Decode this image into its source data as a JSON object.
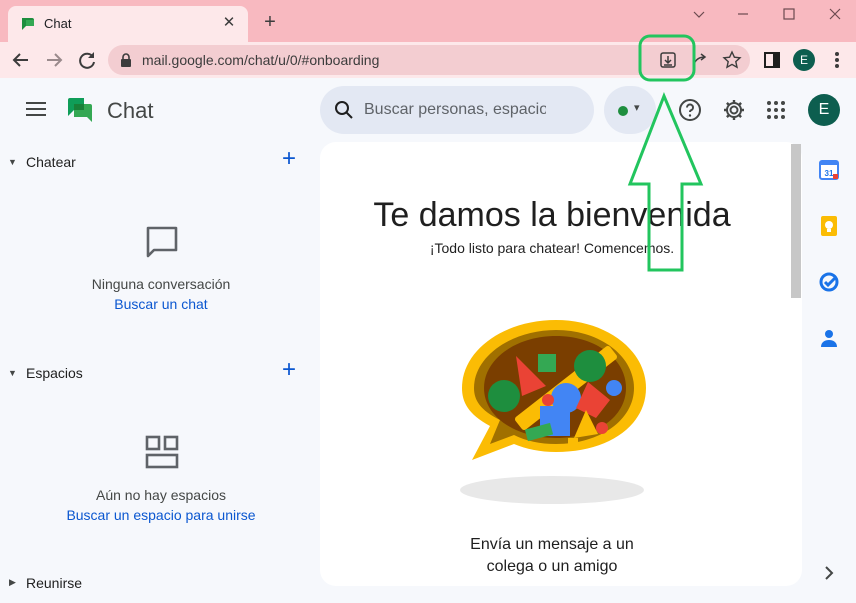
{
  "browser": {
    "tab_title": "Chat",
    "url": "mail.google.com/chat/u/0/#onboarding",
    "profile_initial": "E",
    "new_tab_glyph": "+",
    "close_glyph": "✕"
  },
  "app": {
    "name": "Chat",
    "search_placeholder": "Buscar personas, espacios",
    "status_color": "#1e8e3e",
    "avatar_initial": "E"
  },
  "sidebar": {
    "sections": [
      {
        "title": "Chatear",
        "empty_text": "Ninguna conversación",
        "empty_link": "Buscar un chat"
      },
      {
        "title": "Espacios",
        "empty_text": "Aún no hay espacios",
        "empty_link": "Buscar un espacio para unirse"
      },
      {
        "title": "Reunirse"
      }
    ]
  },
  "main": {
    "title": "Te damos la bienvenida",
    "subtitle": "¡Todo listo para chatear! Comencemos.",
    "cta_line1": "Envía un mensaje a un",
    "cta_line2": "colega o un amigo"
  },
  "side_panel": {
    "calendar_day": "31",
    "icons": [
      "calendar-icon",
      "keep-icon",
      "tasks-icon",
      "contacts-icon"
    ]
  },
  "colors": {
    "accent": "#0b57d0",
    "tab_strip": "#f8b9c0",
    "annotation": "#22c55e"
  }
}
